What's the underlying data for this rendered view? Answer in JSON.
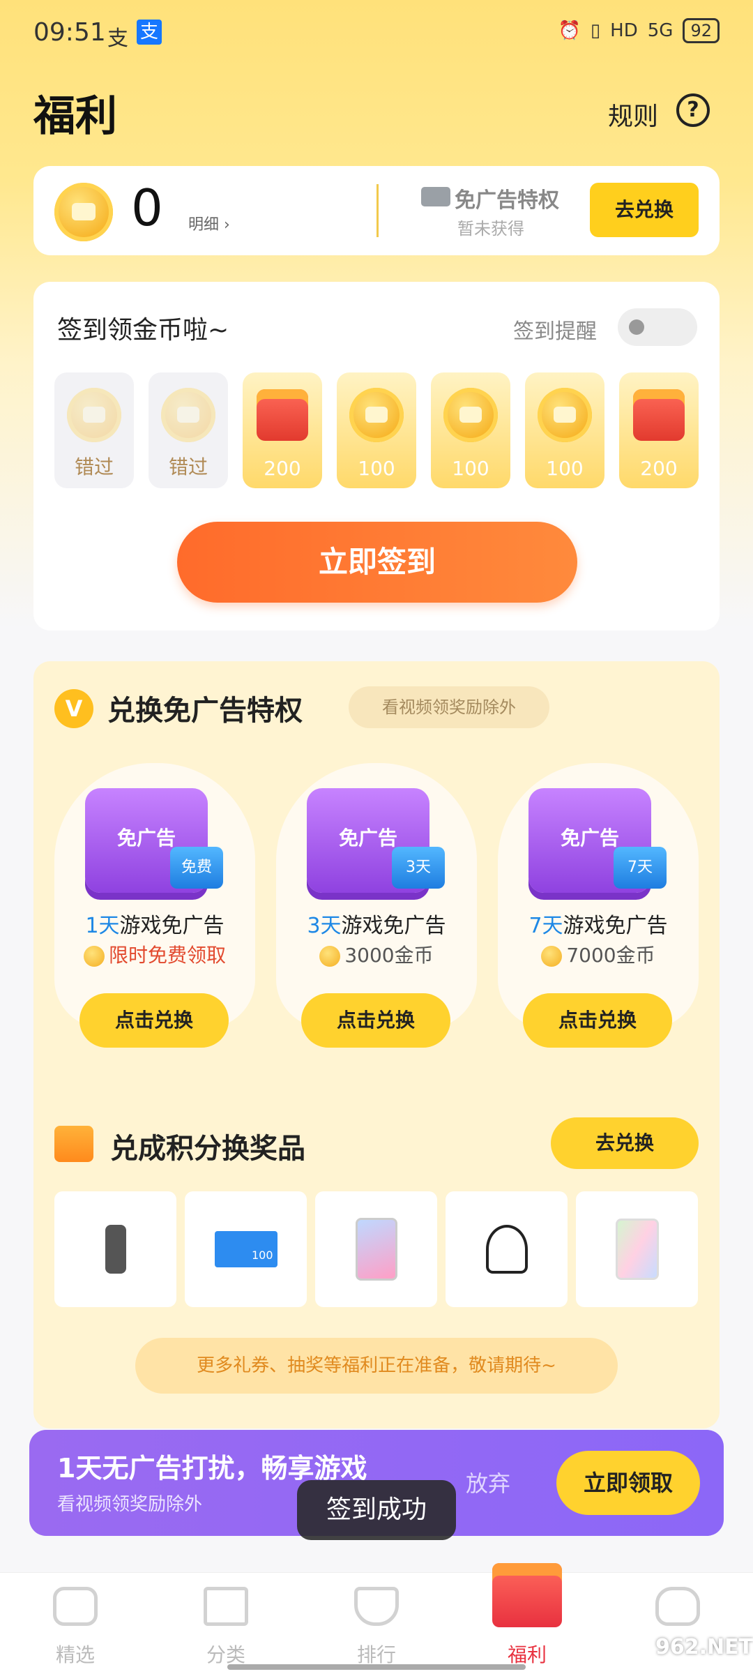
{
  "status_bar": {
    "time": "09:51",
    "alipay_text": "支",
    "alipay_icon": "支",
    "network": "5G",
    "hd": "HD",
    "battery": "92"
  },
  "header": {
    "title": "福利",
    "rules_label": "规则",
    "help_icon": "?"
  },
  "balance": {
    "value": "0",
    "detail": "明细",
    "noad_title": "免广告特权",
    "noad_status": "暂未获得",
    "redeem_label": "去兑换"
  },
  "signin": {
    "title": "签到领金币啦~",
    "remind_label": "签到提醒",
    "days": [
      {
        "label": "错过"
      },
      {
        "label": "错过"
      },
      {
        "label": "200"
      },
      {
        "label": "100"
      },
      {
        "label": "100"
      },
      {
        "label": "100"
      },
      {
        "label": "200"
      }
    ],
    "button_label": "立即签到"
  },
  "redeem": {
    "title": "兑换免广告特权",
    "chip": "看视频领奖励除外",
    "offers": [
      {
        "tv_text": "免广告",
        "badge": "免费",
        "days": "1天",
        "name": "游戏免广告",
        "price": "限时免费领取",
        "button": "点击兑换"
      },
      {
        "tv_text": "免广告",
        "badge": "3天",
        "days": "3天",
        "name": "游戏免广告",
        "price": "3000金币",
        "button": "点击兑换"
      },
      {
        "tv_text": "免广告",
        "badge": "7天",
        "days": "7天",
        "name": "游戏免广告",
        "price": "7000金币",
        "button": "点击兑换"
      }
    ],
    "points_title": "兑成积分换奖品",
    "points_button": "去兑换",
    "card_text": "100",
    "more_text": "更多礼券、抽奖等福利正在准备，敬请期待~"
  },
  "promo": {
    "title": "1天无广告打扰，畅享游戏",
    "subtitle": "看视频领奖励除外",
    "dismiss": "放弃",
    "button": "立即领取"
  },
  "toast": "签到成功",
  "nav": [
    {
      "label": "精选",
      "active": false
    },
    {
      "label": "分类",
      "active": false
    },
    {
      "label": "排行",
      "active": false
    },
    {
      "label": "福利",
      "active": true
    },
    {
      "label": "",
      "active": false
    }
  ],
  "watermark": "962.NET",
  "colors": {
    "accent_yellow": "#ffd22e",
    "signin_orange": "#ff6b2b",
    "promo_purple": "#8c67f7",
    "active_red": "#e8313f"
  }
}
